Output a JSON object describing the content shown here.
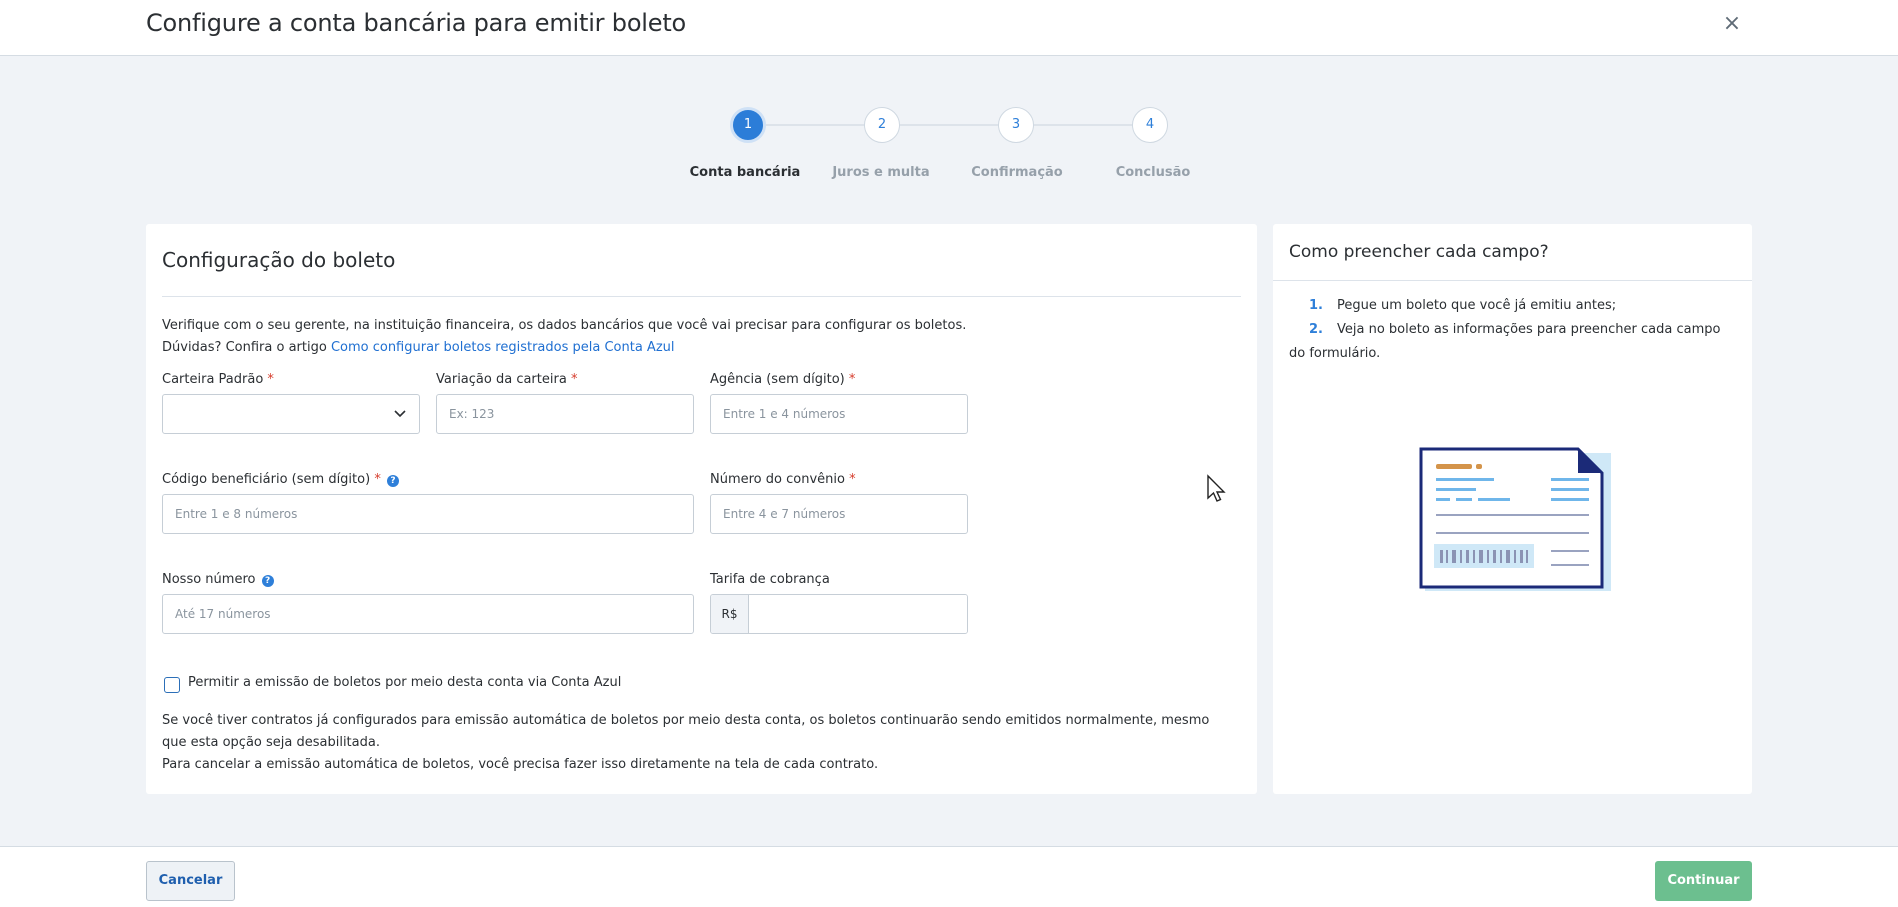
{
  "header": {
    "title": "Configure a conta bancária para emitir boleto",
    "close_icon": "close-icon",
    "close_glyph": "×"
  },
  "stepper": {
    "steps": [
      {
        "number": "1",
        "label": "Conta bancária",
        "active": true
      },
      {
        "number": "2",
        "label": "Juros e multa",
        "active": false
      },
      {
        "number": "3",
        "label": "Confirmação",
        "active": false
      },
      {
        "number": "4",
        "label": "Conclusão",
        "active": false
      }
    ]
  },
  "form": {
    "heading": "Configuração do boleto",
    "intro_line1": "Verifique com o seu gerente, na instituição financeira, os dados bancários que você vai precisar para configurar os boletos.",
    "intro_line2_prefix": "Dúvidas? Confira o artigo ",
    "intro_link": "Como configurar boletos registrados pela Conta Azul",
    "required_mark": "*",
    "help_mark": "?",
    "fields": {
      "carteira": {
        "label": "Carteira Padrão",
        "value": ""
      },
      "variacao": {
        "label": "Variação da carteira",
        "placeholder": "Ex: 123"
      },
      "agencia": {
        "label": "Agência (sem dígito)",
        "placeholder": "Entre 1 e 4 números"
      },
      "codigo": {
        "label": "Código beneficiário (sem dígito)",
        "placeholder": "Entre 1 e 8 números"
      },
      "convenio": {
        "label": "Número do convênio",
        "placeholder": "Entre 4 e 7 números"
      },
      "nosso_numero": {
        "label": "Nosso número",
        "placeholder": "Até 17 números"
      },
      "tarifa": {
        "label": "Tarifa de cobrança",
        "prefix": "R$",
        "value": ""
      }
    },
    "checkbox_label": "Permitir a emissão de boletos por meio desta conta via Conta Azul",
    "checkbox_checked": false,
    "note_line1": "Se você tiver contratos já configurados para emissão automática de boletos por meio desta conta, os boletos continuarão sendo emitidos normalmente, mesmo que esta opção seja desabilitada.",
    "note_line2": "Para cancelar a emissão automática de boletos, você precisa fazer isso diretamente na tela de cada contrato."
  },
  "help": {
    "heading": "Como preencher cada campo?",
    "items": [
      {
        "num": "1.",
        "text": "Pegue um boleto que você já emitiu antes;"
      },
      {
        "num": "2.",
        "text": "Veja no boleto as informações para preencher cada campo do formulário."
      }
    ]
  },
  "footer": {
    "cancel_label": "Cancelar",
    "continue_label": "Continuar"
  },
  "colors": {
    "primary": "#2c7dd8",
    "link": "#1f6fd1",
    "required": "#d63c2c",
    "continue_bg": "#6cbf8f",
    "page_bg": "#f0f3f7"
  }
}
